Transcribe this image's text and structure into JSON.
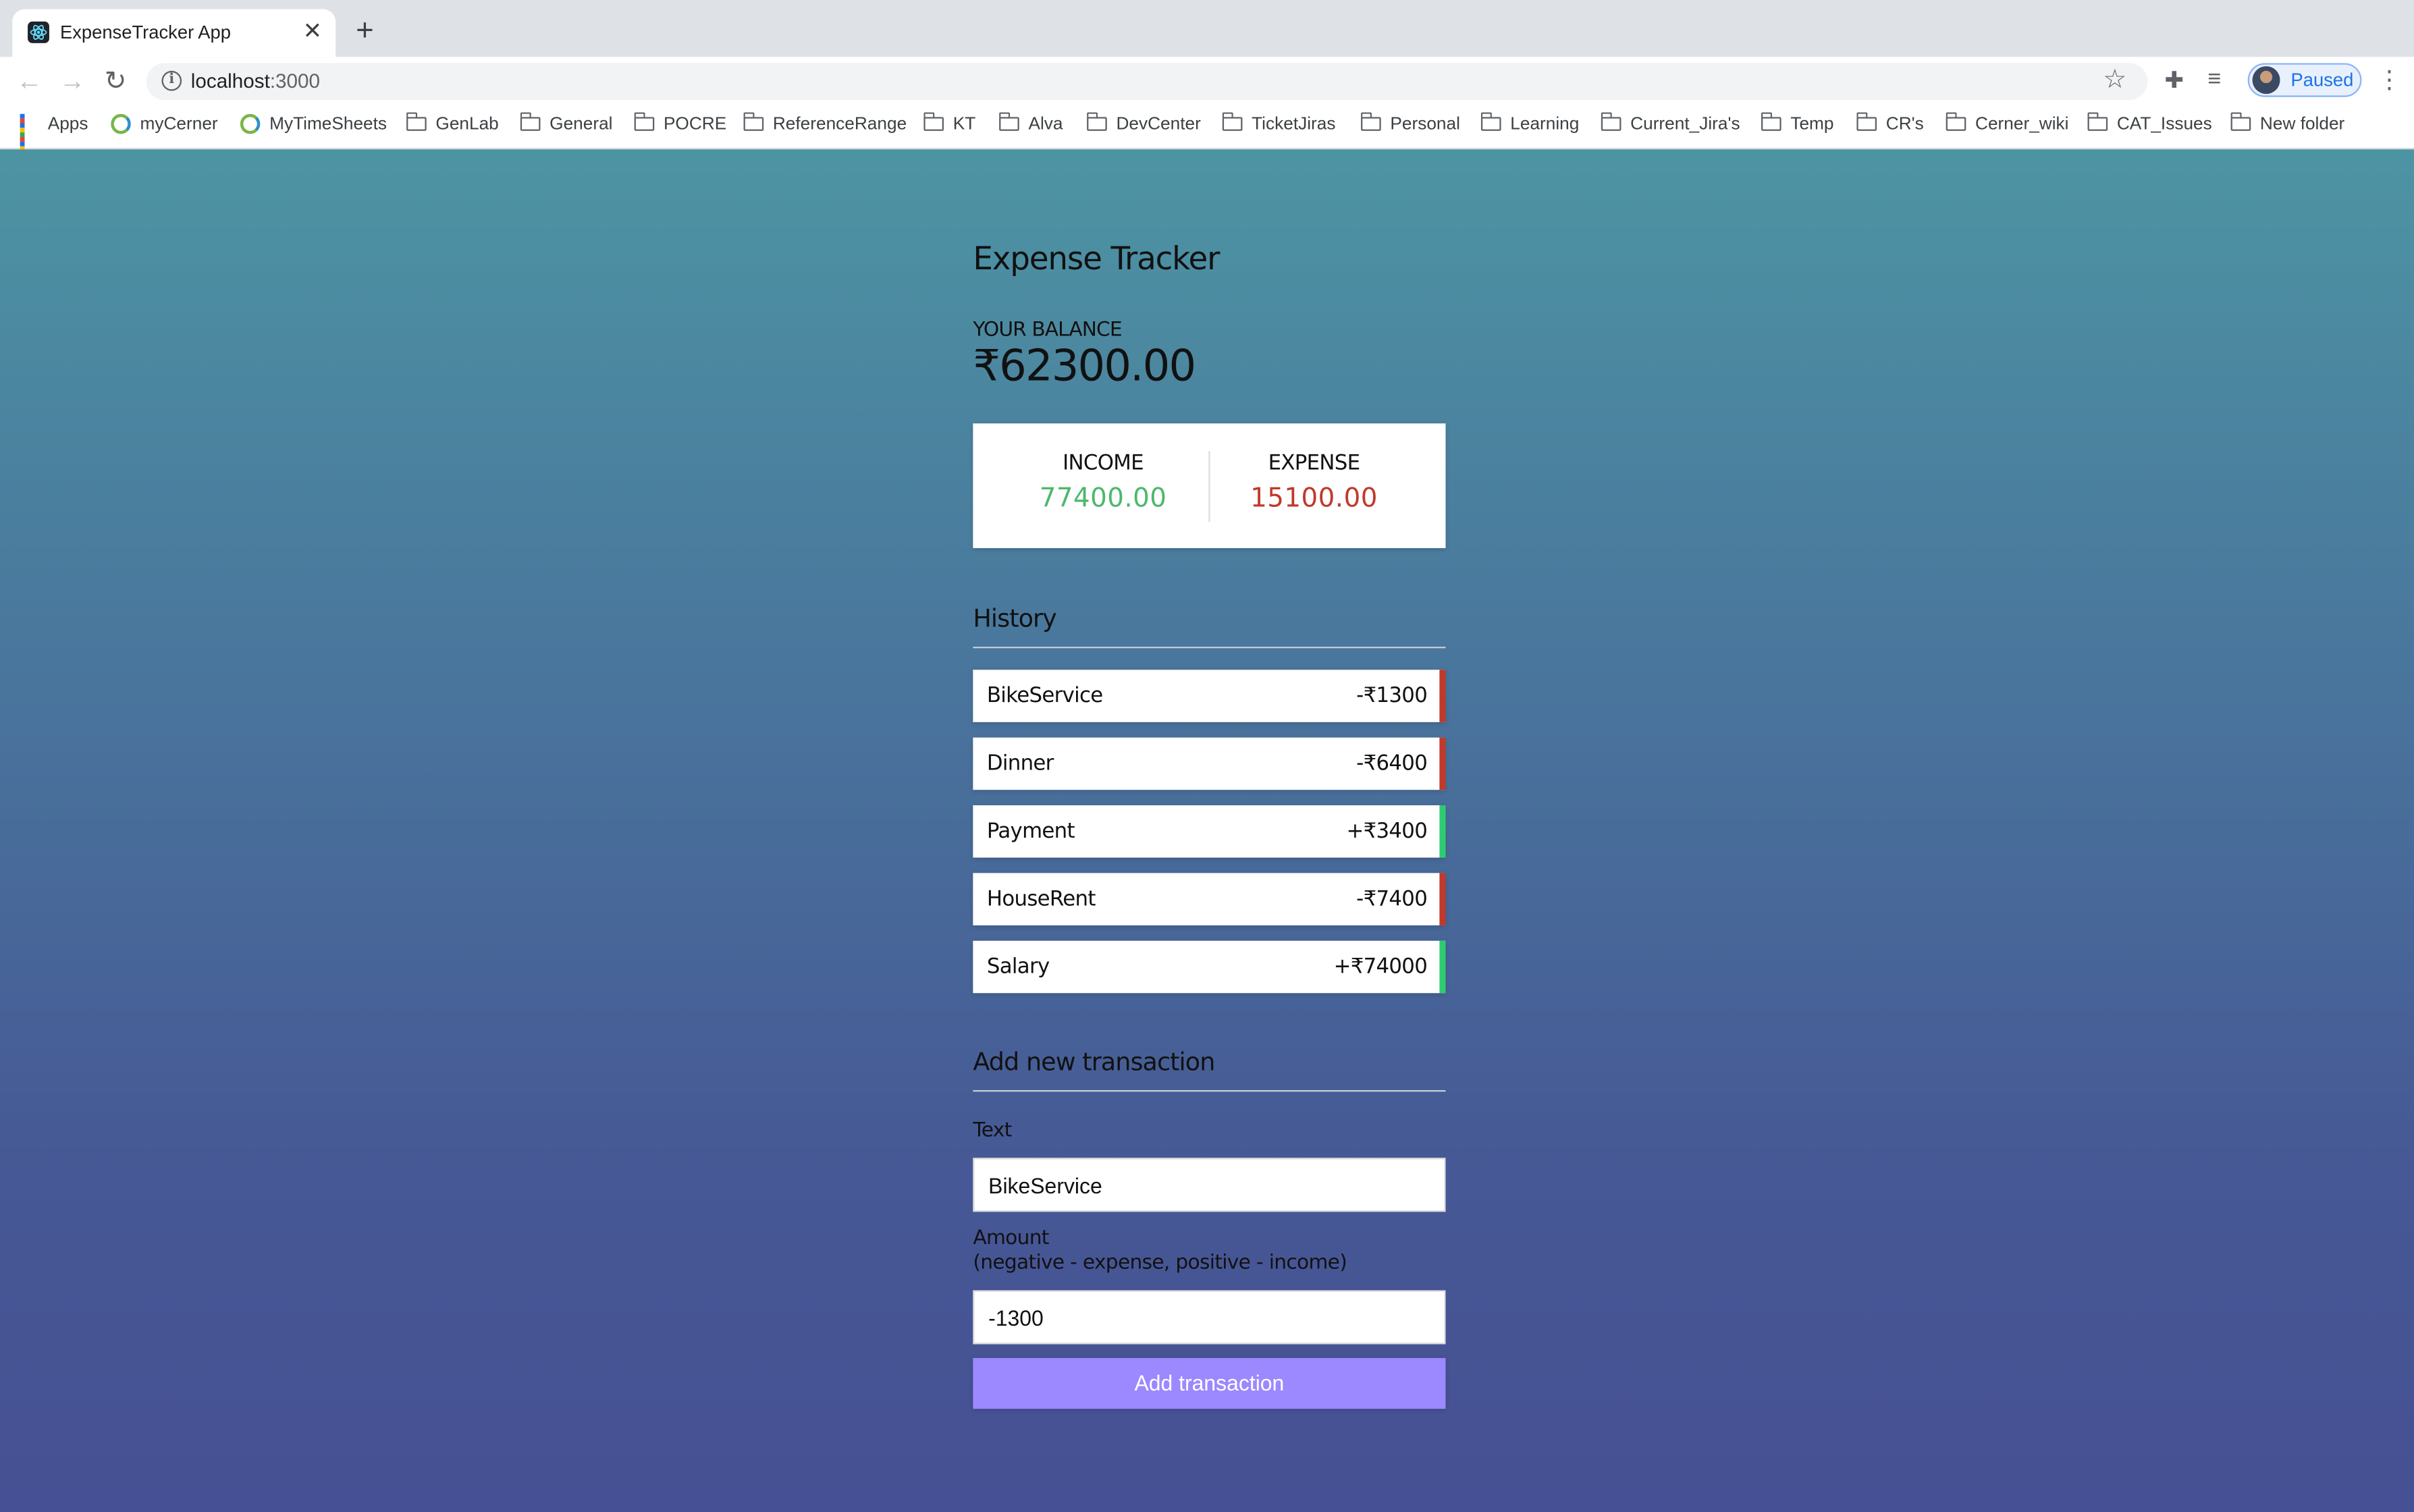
{
  "browser": {
    "tab_title": "ExpenseTracker App",
    "tab_close": "✕",
    "new_tab": "+",
    "url_host": "localhost",
    "url_port": ":3000",
    "profile_status": "Paused",
    "bookmarks": [
      {
        "label": "Apps",
        "icon": "apps-grid-icon"
      },
      {
        "label": "myCerner",
        "icon": "cerner-icon"
      },
      {
        "label": "MyTimeSheets",
        "icon": "cerner-icon"
      },
      {
        "label": "GenLab",
        "icon": "folder-icon"
      },
      {
        "label": "General",
        "icon": "folder-icon"
      },
      {
        "label": "POCRE",
        "icon": "folder-icon"
      },
      {
        "label": "ReferenceRange",
        "icon": "folder-icon"
      },
      {
        "label": "KT",
        "icon": "folder-icon"
      },
      {
        "label": "Alva",
        "icon": "folder-icon"
      },
      {
        "label": "DevCenter",
        "icon": "folder-icon"
      },
      {
        "label": "TicketJiras",
        "icon": "folder-icon"
      },
      {
        "label": "Personal",
        "icon": "folder-icon"
      },
      {
        "label": "Learning",
        "icon": "folder-icon"
      },
      {
        "label": "Current_Jira's",
        "icon": "folder-icon"
      },
      {
        "label": "Temp",
        "icon": "folder-icon"
      },
      {
        "label": "CR's",
        "icon": "folder-icon"
      },
      {
        "label": "Cerner_wiki",
        "icon": "folder-icon"
      },
      {
        "label": "CAT_Issues",
        "icon": "folder-icon"
      },
      {
        "label": "New folder",
        "icon": "folder-icon"
      }
    ]
  },
  "app": {
    "title": "Expense Tracker",
    "balance_label": "YOUR BALANCE",
    "balance_value": "₹62300.00",
    "income_label": "INCOME",
    "income_value": "77400.00",
    "expense_label": "EXPENSE",
    "expense_value": "15100.00",
    "history_title": "History",
    "history": [
      {
        "text": "BikeService",
        "amount": "-₹1300",
        "type": "minus"
      },
      {
        "text": "Dinner",
        "amount": "-₹6400",
        "type": "minus"
      },
      {
        "text": "Payment",
        "amount": "+₹3400",
        "type": "plus"
      },
      {
        "text": "HouseRent",
        "amount": "-₹7400",
        "type": "minus"
      },
      {
        "text": "Salary",
        "amount": "+₹74000",
        "type": "plus"
      }
    ],
    "form": {
      "title": "Add new transaction",
      "text_label": "Text",
      "text_value": "BikeService",
      "amount_label": "Amount",
      "amount_hint": "(negative - expense, positive - income)",
      "amount_value": "-1300",
      "submit_label": "Add transaction"
    }
  },
  "colors": {
    "income": "#4cb86b",
    "expense": "#c0392b",
    "button": "#9c88ff",
    "background_top": "#4d94a3",
    "background_bottom": "#465094"
  }
}
